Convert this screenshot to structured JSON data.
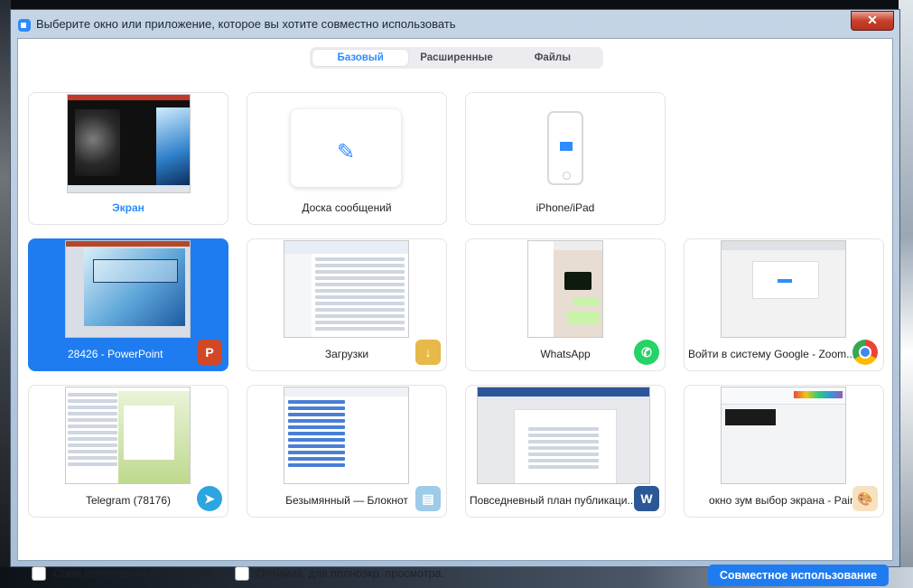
{
  "window": {
    "title": "Выберите окно или приложение, которое вы хотите совместно использовать",
    "close_label": "✕"
  },
  "tabs": [
    {
      "label": "Базовый",
      "active": true
    },
    {
      "label": "Расширенные",
      "active": false
    },
    {
      "label": "Файлы",
      "active": false
    }
  ],
  "tiles": [
    {
      "label": "Экран",
      "icon": "screen-preview"
    },
    {
      "label": "Доска сообщений",
      "icon": "pen-icon"
    },
    {
      "label": "iPhone/iPad",
      "icon": "phone-icon"
    },
    {
      "label": "28426 - PowerPoint",
      "icon": "powerpoint-icon",
      "selected": true
    },
    {
      "label": "Загрузки",
      "icon": "folder-download-icon"
    },
    {
      "label": "WhatsApp",
      "icon": "whatsapp-icon"
    },
    {
      "label": "Войти в систему Google - Zoom...",
      "icon": "chrome-icon"
    },
    {
      "label": "Telegram (78176)",
      "icon": "telegram-icon"
    },
    {
      "label": "Безымянный — Блокнот",
      "icon": "notepad-icon"
    },
    {
      "label": "Повседневный план публикаци...",
      "icon": "word-icon"
    },
    {
      "label": "окно зум выбор экрана - Paint",
      "icon": "paint-icon"
    }
  ],
  "options": {
    "share_audio": "Совм.испол.звука компьютера",
    "optimize_fullscreen": "Оптимиз. для полноэкр. просмотра."
  },
  "share_button": "Совместное использование",
  "colors": {
    "accent": "#2d8cff",
    "selected_tile": "#1f7cf0",
    "powerpoint": "#d24726",
    "word": "#2b5797",
    "whatsapp": "#25d366",
    "telegram": "#2ca5e0"
  }
}
